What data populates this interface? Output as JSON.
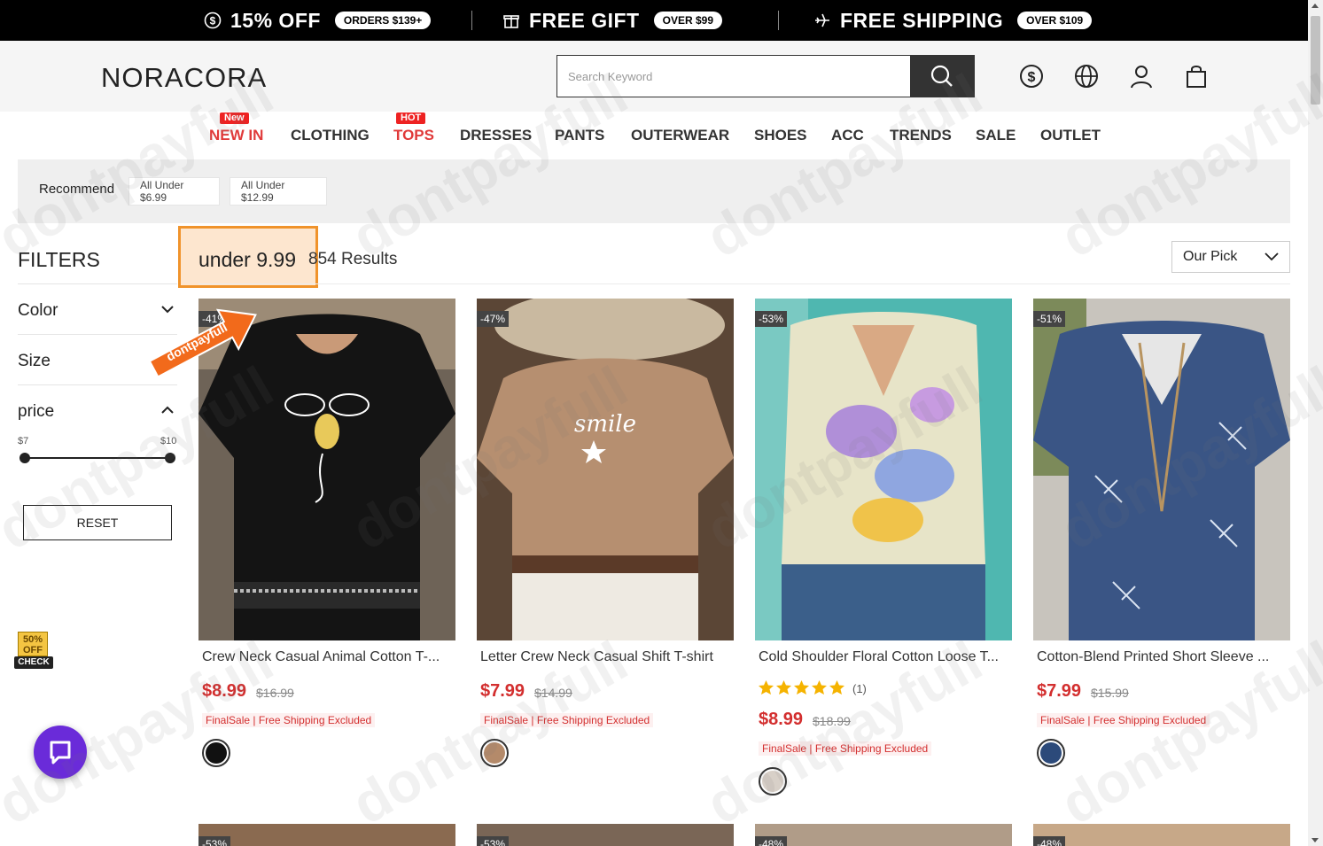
{
  "promo": {
    "items": [
      {
        "icon": "dollar-circle-icon",
        "title": "15% OFF",
        "pill": "ORDERS $139+"
      },
      {
        "icon": "gift-icon",
        "title": "FREE GIFT",
        "pill": "OVER $99"
      },
      {
        "icon": "plane-icon",
        "title": "FREE SHIPPING",
        "pill": "OVER $109"
      }
    ]
  },
  "header": {
    "logo": "NORACORA",
    "search_placeholder": "Search Keyword",
    "icons": [
      "currency-icon",
      "globe-icon",
      "user-icon",
      "bag-icon"
    ]
  },
  "nav": {
    "items": [
      {
        "label": "NEW IN",
        "badge": "New",
        "highlight": true
      },
      {
        "label": "CLOTHING"
      },
      {
        "label": "TOPS",
        "badge": "HOT",
        "highlight": true
      },
      {
        "label": "DRESSES"
      },
      {
        "label": "PANTS"
      },
      {
        "label": "OUTERWEAR"
      },
      {
        "label": "SHOES"
      },
      {
        "label": "ACC"
      },
      {
        "label": "TRENDS"
      },
      {
        "label": "SALE"
      },
      {
        "label": "OUTLET"
      }
    ]
  },
  "recommend": {
    "label": "Recommend",
    "chips": [
      "All Under $6.99",
      "All Under $12.99"
    ]
  },
  "filters": {
    "title": "FILTERS",
    "rows": [
      "Color",
      "Size",
      "price"
    ],
    "price_min": "$7",
    "price_max": "$10",
    "reset_label": "RESET"
  },
  "results": {
    "query": "under 9.99",
    "count": "854 Results",
    "sort_value": "Our Pick"
  },
  "products": [
    {
      "discount": "-41%",
      "name": "Crew Neck Casual Animal Cotton T-...",
      "price": "$8.99",
      "old_price": "$16.99",
      "note": "FinalSale | Free Shipping Excluded",
      "swatch": "#111111"
    },
    {
      "discount": "-47%",
      "name": "Letter Crew Neck Casual Shift T-shirt",
      "price": "$7.99",
      "old_price": "$14.99",
      "note": "FinalSale | Free Shipping Excluded",
      "swatch": "#b48a6a"
    },
    {
      "discount": "-53%",
      "name": "Cold Shoulder Floral Cotton Loose T...",
      "rating": 5,
      "reviews": "(1)",
      "price": "$8.99",
      "old_price": "$18.99",
      "note": "FinalSale | Free Shipping Excluded",
      "swatch": "#d8d0c8"
    },
    {
      "discount": "-51%",
      "name": "Cotton-Blend Printed Short Sleeve ...",
      "price": "$7.99",
      "old_price": "$15.99",
      "note": "FinalSale | Free Shipping Excluded",
      "swatch": "#2c4a7a"
    }
  ],
  "next_row_discounts": [
    "-53%",
    "-53%",
    "-48%",
    "-48%"
  ],
  "widgets": {
    "badge_top": "50% OFF",
    "badge_bottom": "CHECK",
    "sticker_text": "dontpayfull",
    "watermark": "dontpayfull"
  },
  "colors": {
    "accent_red": "#d32f2f",
    "query_highlight": "#f0932b",
    "chat_purple": "#6a2bd9"
  }
}
